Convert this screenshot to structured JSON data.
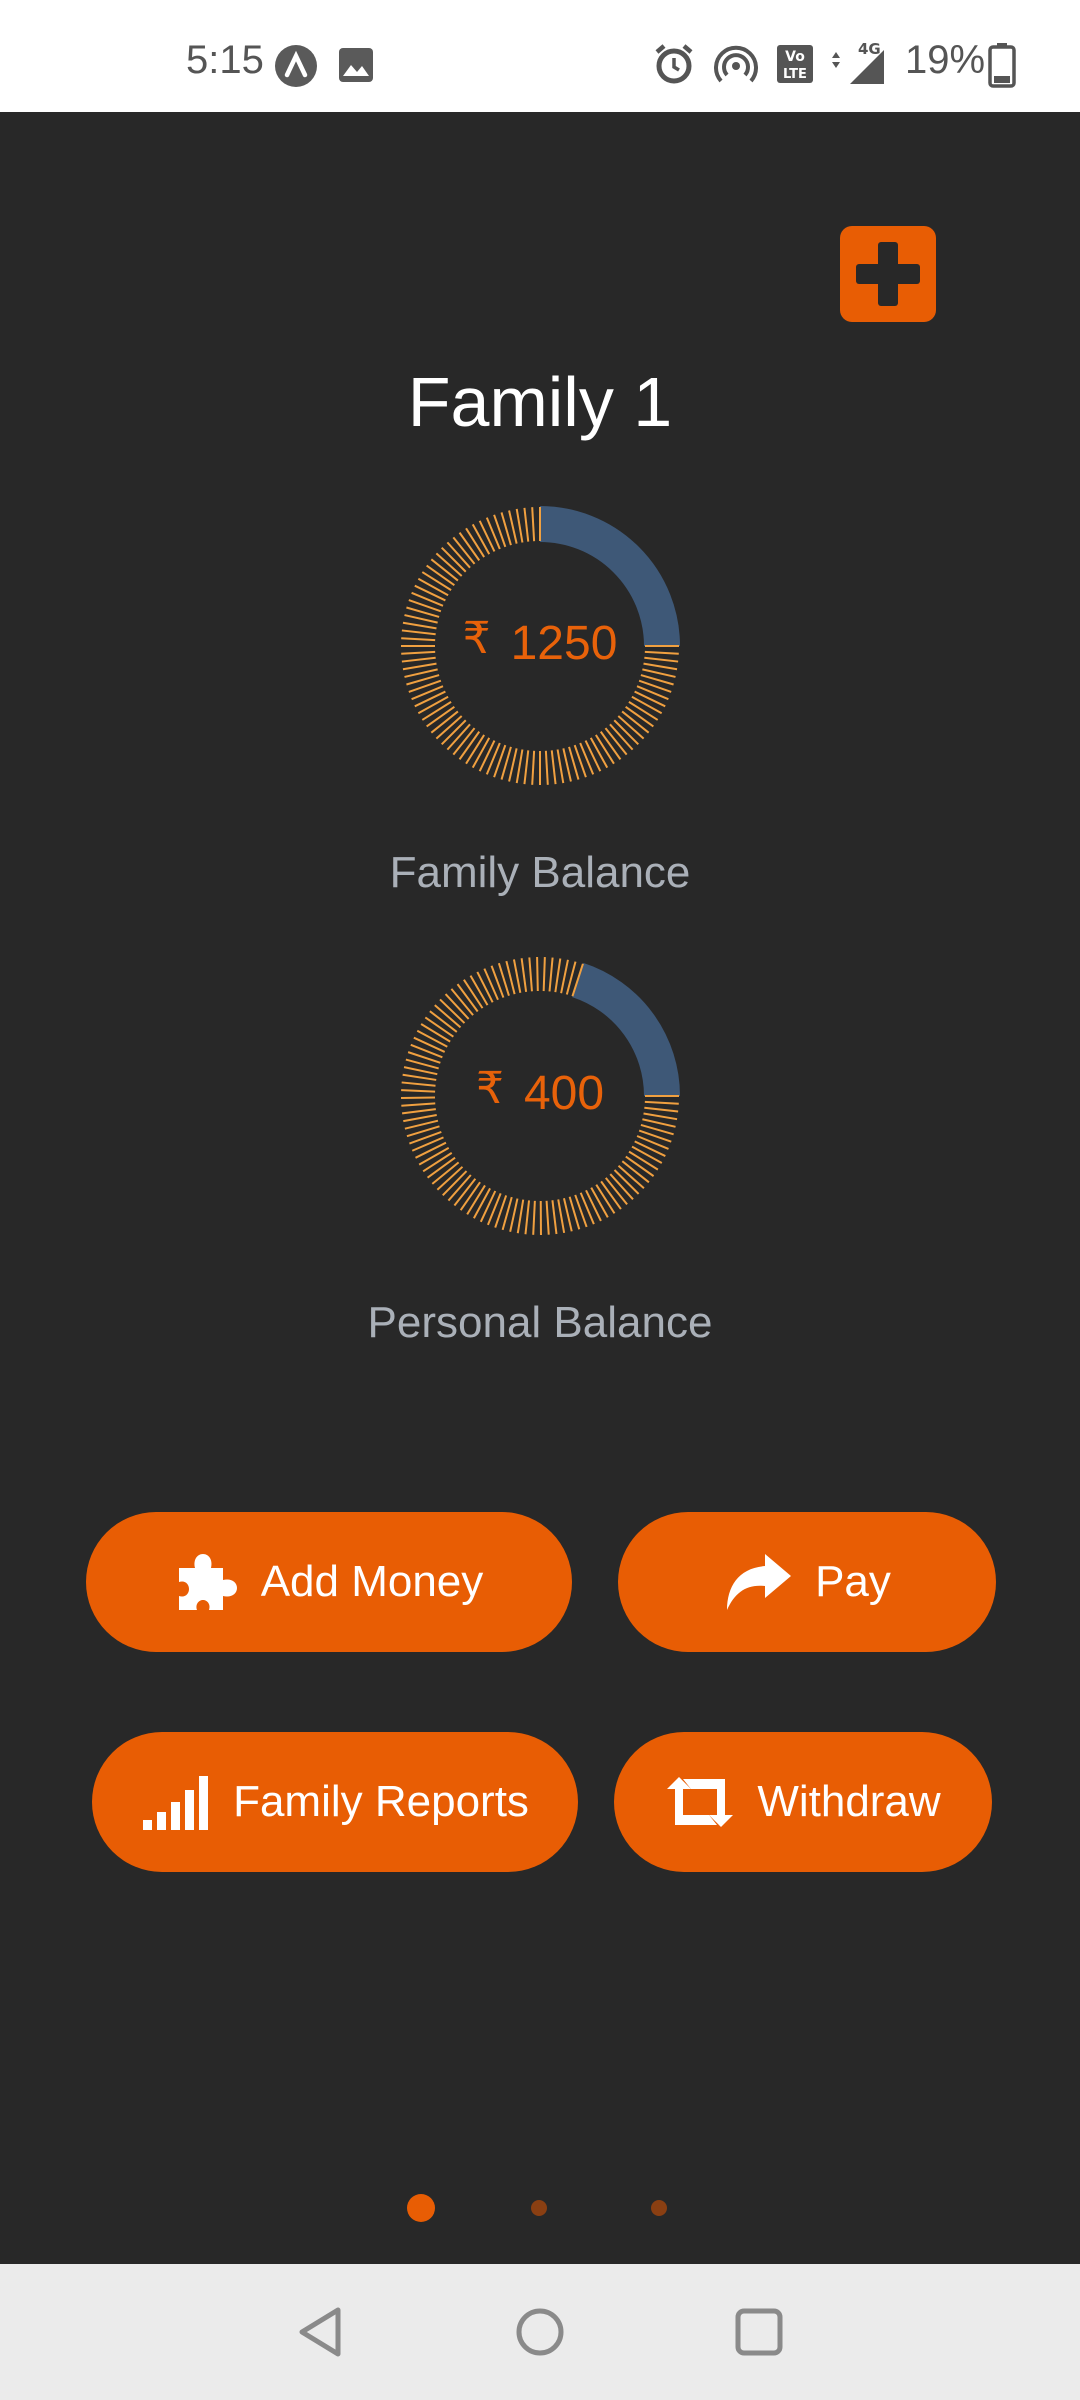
{
  "status_bar": {
    "time": "5:15",
    "battery_percent": "19%",
    "network": "4G",
    "icons": [
      "app-logo-icon",
      "image-icon",
      "alarm-icon",
      "hotspot-icon",
      "volte-icon",
      "signal-icon",
      "battery-icon"
    ]
  },
  "header": {
    "title": "Family 1",
    "add_icon": "plus-icon"
  },
  "balances": [
    {
      "currency": "₹",
      "amount": "1250",
      "label": "Family Balance",
      "filled_fraction": 0.75
    },
    {
      "currency": "₹",
      "amount": "400",
      "label": "Personal Balance",
      "filled_fraction": 0.8
    }
  ],
  "actions": {
    "add_money": {
      "label": "Add Money",
      "icon": "puzzle-icon"
    },
    "pay": {
      "label": "Pay",
      "icon": "share-arrow-icon"
    },
    "family_reports": {
      "label": "Family Reports",
      "icon": "signal-bars-icon"
    },
    "withdraw": {
      "label": "Withdraw",
      "icon": "retweet-icon"
    }
  },
  "pagination": {
    "current_page": 1,
    "total_pages": 3
  },
  "colors": {
    "accent": "#e85d04",
    "background": "#282828",
    "donut_blue": "#3e5877",
    "donut_orange": "#f0a040"
  },
  "nav_bar": {
    "buttons": [
      "back-icon",
      "home-icon",
      "recents-icon"
    ]
  }
}
